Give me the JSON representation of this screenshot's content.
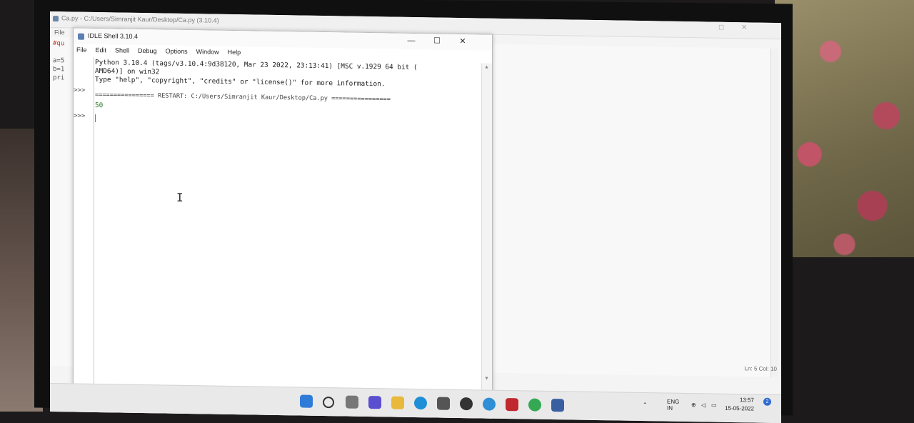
{
  "bg_window": {
    "title": "Ca.py - C:/Users/Simranjit Kaur/Desktop/Ca.py (3.10.4)",
    "menu_file": "File",
    "code_lines": [
      "#qu",
      "a=5",
      "b=1",
      "pri"
    ],
    "status": "Ln: 5  Col: 10"
  },
  "shell_window": {
    "title": "IDLE Shell 3.10.4",
    "menus": [
      "File",
      "Edit",
      "Shell",
      "Debug",
      "Options",
      "Window",
      "Help"
    ],
    "minimize": "—",
    "maximize": "☐",
    "close": "✕",
    "lines": [
      "Python 3.10.4 (tags/v3.10.4:9d38120, Mar 23 2022, 23:13:41) [MSC v.1929 64 bit (",
      "AMD64)] on win32",
      "Type \"help\", \"copyright\", \"credits\" or \"license()\" for more information.",
      "================ RESTART: C:/Users/Simranjit Kaur/Desktop/Ca.py ================",
      "50"
    ],
    "prompt": ">>>"
  },
  "taskbar": {
    "lang_top": "ENG",
    "lang_bottom": "IN",
    "time": "13:57",
    "date": "15-05-2022",
    "notification_count": "2"
  },
  "colors": {
    "accent": "#2f6bd0",
    "output_green": "#2a7a2a"
  }
}
